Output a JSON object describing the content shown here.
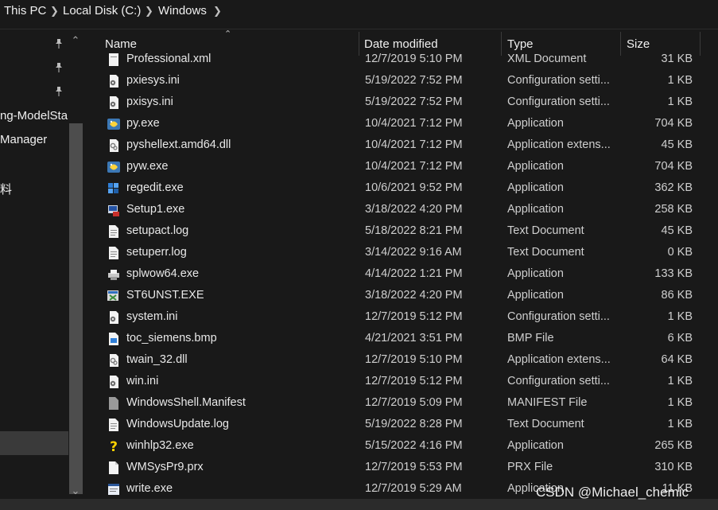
{
  "breadcrumbs": [
    {
      "label": "This PC"
    },
    {
      "label": "Local Disk (C:)"
    },
    {
      "label": "Windows"
    }
  ],
  "nav": {
    "items": [
      {
        "label": "ng-ModelSta"
      },
      {
        "label": "Manager"
      },
      {
        "label": "料"
      }
    ]
  },
  "columns": {
    "name": "Name",
    "date": "Date modified",
    "type": "Type",
    "size": "Size"
  },
  "files": [
    {
      "name": "Professional.xml",
      "date": "12/7/2019 5:10 PM",
      "type": "XML Document",
      "size": "31 KB",
      "icon": "xml-file-icon"
    },
    {
      "name": "pxiesys.ini",
      "date": "5/19/2022 7:52 PM",
      "type": "Configuration setti...",
      "size": "1 KB",
      "icon": "config-file-icon"
    },
    {
      "name": "pxisys.ini",
      "date": "5/19/2022 7:52 PM",
      "type": "Configuration setti...",
      "size": "1 KB",
      "icon": "config-file-icon"
    },
    {
      "name": "py.exe",
      "date": "10/4/2021 7:12 PM",
      "type": "Application",
      "size": "704 KB",
      "icon": "python-icon"
    },
    {
      "name": "pyshellext.amd64.dll",
      "date": "10/4/2021 7:12 PM",
      "type": "Application extens...",
      "size": "45 KB",
      "icon": "dll-file-icon"
    },
    {
      "name": "pyw.exe",
      "date": "10/4/2021 7:12 PM",
      "type": "Application",
      "size": "704 KB",
      "icon": "python-icon"
    },
    {
      "name": "regedit.exe",
      "date": "10/6/2021 9:52 PM",
      "type": "Application",
      "size": "362 KB",
      "icon": "regedit-icon"
    },
    {
      "name": "Setup1.exe",
      "date": "3/18/2022 4:20 PM",
      "type": "Application",
      "size": "258 KB",
      "icon": "setup-icon"
    },
    {
      "name": "setupact.log",
      "date": "5/18/2022 8:21 PM",
      "type": "Text Document",
      "size": "45 KB",
      "icon": "text-file-icon"
    },
    {
      "name": "setuperr.log",
      "date": "3/14/2022 9:16 AM",
      "type": "Text Document",
      "size": "0 KB",
      "icon": "text-file-icon"
    },
    {
      "name": "splwow64.exe",
      "date": "4/14/2022 1:21 PM",
      "type": "Application",
      "size": "133 KB",
      "icon": "printer-icon"
    },
    {
      "name": "ST6UNST.EXE",
      "date": "3/18/2022 4:20 PM",
      "type": "Application",
      "size": "86 KB",
      "icon": "uninstall-icon"
    },
    {
      "name": "system.ini",
      "date": "12/7/2019 5:12 PM",
      "type": "Configuration setti...",
      "size": "1 KB",
      "icon": "config-file-icon"
    },
    {
      "name": "toc_siemens.bmp",
      "date": "4/21/2021 3:51 PM",
      "type": "BMP File",
      "size": "6 KB",
      "icon": "bmp-file-icon"
    },
    {
      "name": "twain_32.dll",
      "date": "12/7/2019 5:10 PM",
      "type": "Application extens...",
      "size": "64 KB",
      "icon": "dll-file-icon"
    },
    {
      "name": "win.ini",
      "date": "12/7/2019 5:12 PM",
      "type": "Configuration setti...",
      "size": "1 KB",
      "icon": "config-file-icon"
    },
    {
      "name": "WindowsShell.Manifest",
      "date": "12/7/2019 5:09 PM",
      "type": "MANIFEST File",
      "size": "1 KB",
      "icon": "manifest-file-icon"
    },
    {
      "name": "WindowsUpdate.log",
      "date": "5/19/2022 8:28 PM",
      "type": "Text Document",
      "size": "1 KB",
      "icon": "text-file-icon"
    },
    {
      "name": "winhlp32.exe",
      "date": "5/15/2022 4:16 PM",
      "type": "Application",
      "size": "265 KB",
      "icon": "help-icon"
    },
    {
      "name": "WMSysPr9.prx",
      "date": "12/7/2019 5:53 PM",
      "type": "PRX File",
      "size": "310 KB",
      "icon": "blank-file-icon"
    },
    {
      "name": "write.exe",
      "date": "12/7/2019 5:29 AM",
      "type": "Application",
      "size": "11 KB",
      "icon": "write-icon"
    }
  ],
  "watermark": "CSDN @Michael_chemic",
  "colors": {
    "background": "#191919",
    "text": "#e6e6e6",
    "scrollbar_thumb": "#4d4d4d",
    "selection": "#3a3a3a"
  }
}
